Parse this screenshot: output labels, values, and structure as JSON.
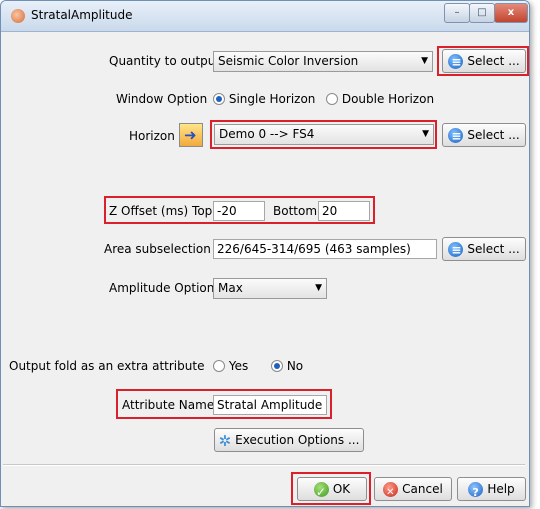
{
  "window": {
    "title": "StratalAmplitude",
    "minimize": "–",
    "maximize": "□",
    "close": "x"
  },
  "quantity": {
    "label": "Quantity to output",
    "value": "Seismic Color Inversion",
    "select_label": "Select ..."
  },
  "window_option": {
    "label": "Window Option",
    "single": "Single Horizon",
    "double": "Double Horizon",
    "selected": "single"
  },
  "horizon": {
    "label": "Horizon",
    "value": "Demo 0 --> FS4",
    "select_label": "Select ..."
  },
  "z_offset": {
    "label": "Z Offset (ms) Top",
    "top_value": "-20",
    "bottom_label": "Bottom",
    "bottom_value": "20"
  },
  "area": {
    "label": "Area subselection",
    "value": "226/645-314/695 (463 samples)",
    "select_label": "Select ..."
  },
  "amplitude": {
    "label": "Amplitude Option",
    "value": "Max"
  },
  "output_fold": {
    "label": "Output fold as an extra attribute",
    "yes": "Yes",
    "no": "No",
    "selected": "no"
  },
  "attribute_name": {
    "label": "Attribute Name",
    "value": "Stratal Amplitude"
  },
  "execution": {
    "label": "Execution Options ..."
  },
  "footer": {
    "ok": "OK",
    "cancel": "Cancel",
    "help": "Help"
  },
  "colors": {
    "highlight": "#d9202b",
    "select_icon": "#1662c4"
  }
}
